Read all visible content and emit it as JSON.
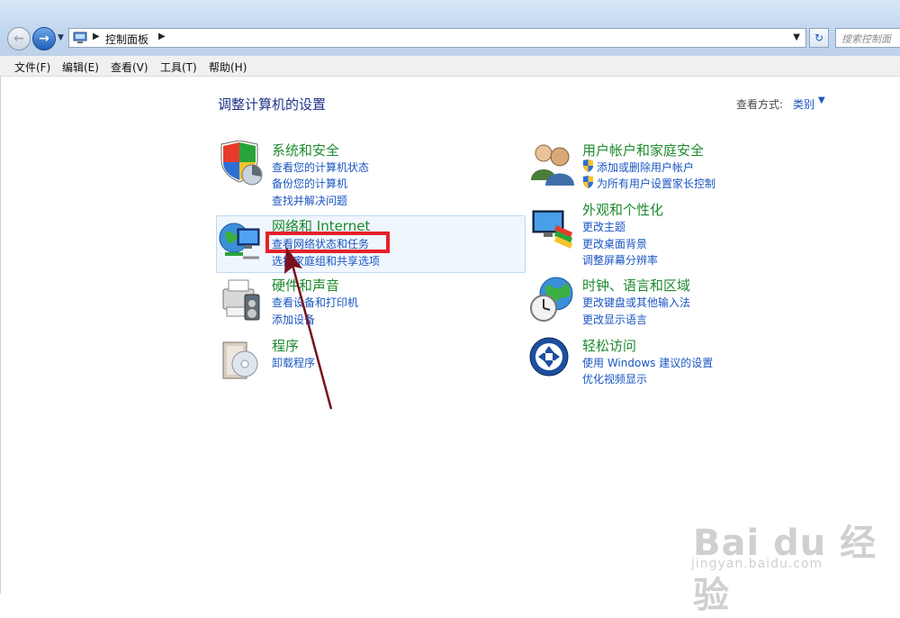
{
  "address_bar": {
    "path": "控制面板",
    "search_placeholder": "搜索控制面"
  },
  "menu": [
    "文件(F)",
    "编辑(E)",
    "查看(V)",
    "工具(T)",
    "帮助(H)"
  ],
  "page": {
    "title": "调整计算机的设置",
    "view_by_label": "查看方式:",
    "view_by_value": "类别"
  },
  "categories": {
    "system": {
      "title": "系统和安全",
      "links": [
        "查看您的计算机状态",
        "备份您的计算机",
        "查找并解决问题"
      ]
    },
    "network": {
      "title": "网络和 Internet",
      "links": [
        "查看网络状态和任务",
        "选择家庭组和共享选项"
      ]
    },
    "hardware": {
      "title": "硬件和声音",
      "links": [
        "查看设备和打印机",
        "添加设备"
      ]
    },
    "programs": {
      "title": "程序",
      "links": [
        "卸载程序"
      ]
    },
    "users": {
      "title": "用户帐户和家庭安全",
      "links": [
        "添加或删除用户帐户",
        "为所有用户设置家长控制"
      ]
    },
    "appearance": {
      "title": "外观和个性化",
      "links": [
        "更改主题",
        "更改桌面背景",
        "调整屏幕分辨率"
      ]
    },
    "clock": {
      "title": "时钟、语言和区域",
      "links": [
        "更改键盘或其他输入法",
        "更改显示语言"
      ]
    },
    "ease": {
      "title": "轻松访问",
      "links": [
        "使用 Windows 建议的设置",
        "优化视频显示"
      ]
    }
  },
  "watermark": {
    "logo": "Bai du 经验",
    "url": "jingyan.baidu.com"
  }
}
